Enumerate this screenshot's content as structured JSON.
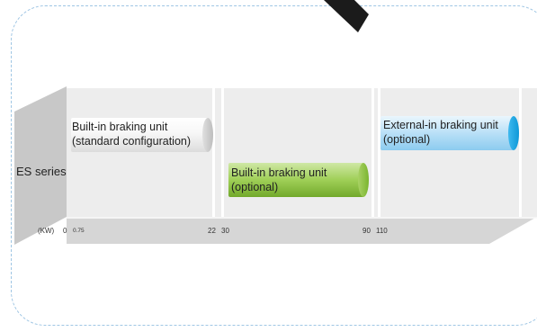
{
  "series_label": "ES series",
  "unit_label": "(KW)",
  "ticks": [
    "0",
    "0.75",
    "22",
    "30",
    "90",
    "110"
  ],
  "bars": [
    {
      "line1": "Built-in braking unit",
      "line2": "(standard configuration)",
      "range_kw": [
        "0.75",
        "22"
      ],
      "color": "#cfcfcf"
    },
    {
      "line1": "Built-in braking unit",
      "line2": "(optional)",
      "range_kw": [
        "30",
        "90"
      ],
      "color": "#86bd3e"
    },
    {
      "line1": "External-in  braking unit",
      "line2": "(optional)",
      "range_kw": [
        "110",
        ""
      ],
      "color": "#9dd1f0"
    }
  ],
  "colors": {
    "stage": "#ededed",
    "panel": "#c8c8c8",
    "frame": "#9fc6e4",
    "cap_blue": "#14a6e6"
  }
}
